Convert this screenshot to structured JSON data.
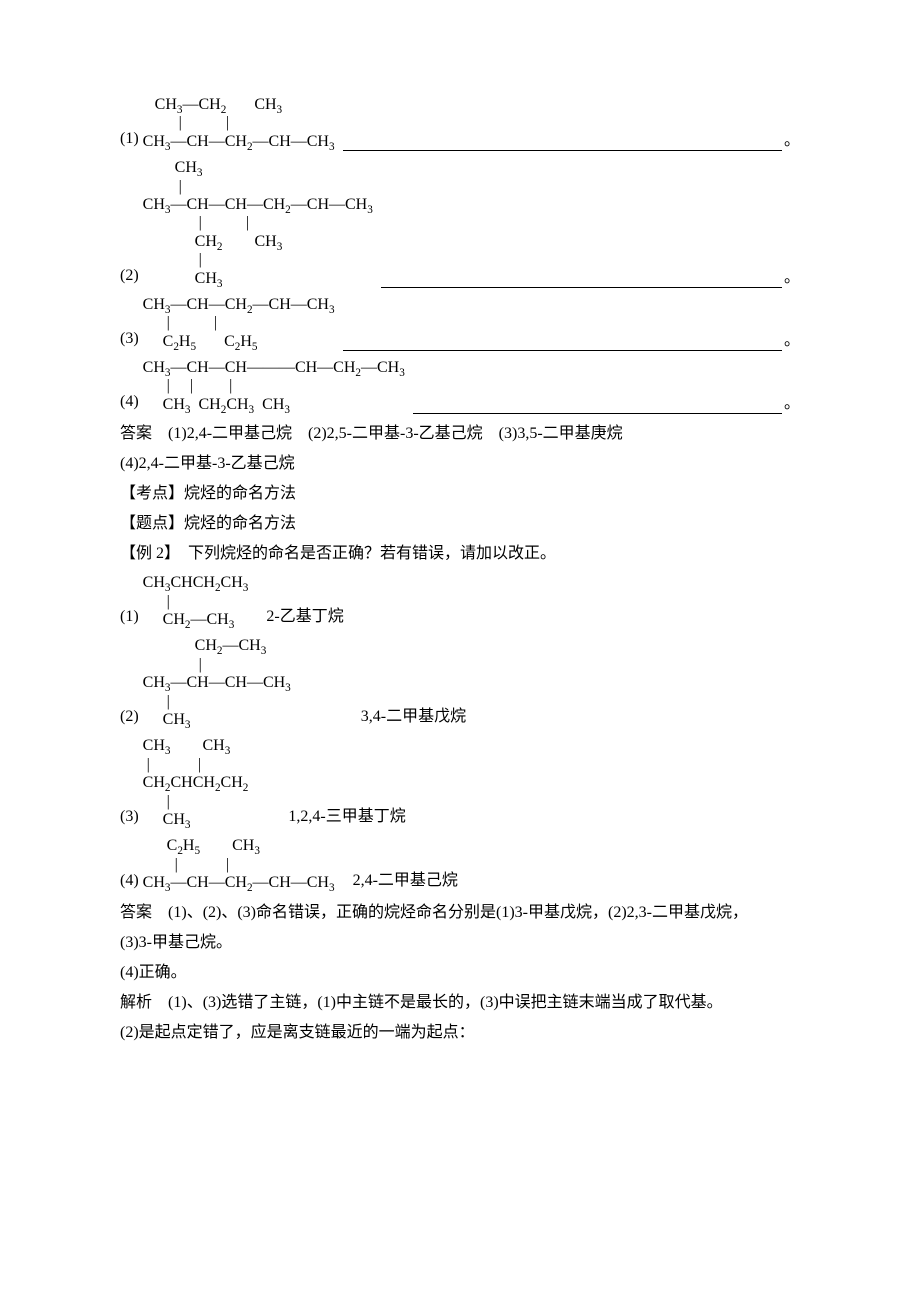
{
  "q1": {
    "items": [
      {
        "prefix": "(1)",
        "structure": "   CH₃—CH₂       CH₃\n         |           |\nCH₃—CH—CH₂—CH—CH₃"
      },
      {
        "prefix": "(2)",
        "structure": "        CH₃\n         |\nCH₃—CH—CH—CH₂—CH—CH₃\n              |           |\n             CH₂        CH₃\n              |\n             CH₃"
      },
      {
        "prefix": "(3)",
        "structure": "CH₃—CH—CH₂—CH—CH₃\n      |           |\n     C₂H₅       C₂H₅"
      },
      {
        "prefix": "(4)",
        "structure": "CH₃—CH—CH———CH—CH₂—CH₃\n      |     |         |\n     CH₃  CH₂CH₃  CH₃"
      }
    ],
    "answer_label": "答案",
    "answer": "(1)2,4-二甲基己烷　(2)2,5-二甲基-3-乙基己烷　(3)3,5-二甲基庚烷",
    "answer_line2": "(4)2,4-二甲基-3-乙基己烷",
    "kaodian_label": "【考点】",
    "kaodian": "烷烃的命名方法",
    "tidian_label": "【题点】",
    "tidian": "烷烃的命名方法"
  },
  "q2": {
    "stem_label": "【例 2】",
    "stem": "下列烷烃的命名是否正确？若有错误，请加以改正。",
    "items": [
      {
        "prefix": "(1)",
        "structure": "CH₃CHCH₂CH₃\n      |\n     CH₂—CH₃",
        "name": "2-乙基丁烷"
      },
      {
        "prefix": "(2)",
        "structure": "             CH₂—CH₃\n              |\nCH₃—CH—CH—CH₃\n      |\n     CH₃",
        "name": "3,4-二甲基戊烷"
      },
      {
        "prefix": "(3)",
        "structure": "CH₃        CH₃\n |            |\nCH₂CHCH₂CH₂\n      |\n     CH₃",
        "name": "1,2,4-三甲基丁烷"
      },
      {
        "prefix": "(4)",
        "structure": "      C₂H₅        CH₃\n        |            |\nCH₃—CH—CH₂—CH—CH₃",
        "name": "2,4-二甲基己烷"
      }
    ],
    "answer_label": "答案",
    "answer": "(1)、(2)、(3)命名错误，正确的烷烃命名分别是(1)3-甲基戊烷，(2)2,3-二甲基戊烷，",
    "answer_line2": "(3)3-甲基己烷。",
    "answer_line3": "(4)正确。",
    "jiexi_label": "解析",
    "jiexi": "(1)、(3)选错了主链，(1)中主链不是最长的，(3)中误把主链末端当成了取代基。",
    "jiexi_line2": "(2)是起点定错了，应是离支链最近的一端为起点："
  }
}
